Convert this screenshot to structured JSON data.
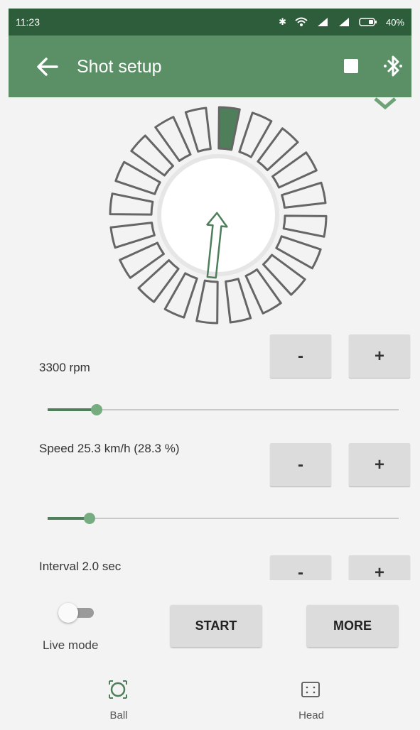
{
  "status_bar": {
    "time": "11:23",
    "battery": "40%",
    "icons": [
      "bluetooth-icon",
      "wifi-icon",
      "signal-icon",
      "signal-icon",
      "battery-icon"
    ]
  },
  "app_bar": {
    "title": "Shot setup",
    "icons": [
      "back-arrow-icon",
      "stop-icon",
      "bluetooth-icon"
    ]
  },
  "dial": {
    "segment_count": 20,
    "selected_segment": 0,
    "arrow_direction": "toward selected segment"
  },
  "controls": {
    "rpm": {
      "label": "3300 rpm",
      "minus": "-",
      "plus": "+",
      "level": 0.14
    },
    "speed": {
      "label": "Speed 25.3 km/h (28.3 %)",
      "minus": "-",
      "plus": "+",
      "level": 0.12
    },
    "interval": {
      "label": "Interval 2.0 sec",
      "minus": "-",
      "plus": "+"
    }
  },
  "bottom": {
    "live_mode": {
      "label": "Live mode",
      "on": false
    },
    "start_label": "START",
    "more_label": "MORE",
    "nav": [
      {
        "label": "Ball",
        "icon": "ball-icon",
        "active": true
      },
      {
        "label": "Head",
        "icon": "head-icon",
        "active": false
      }
    ]
  },
  "colors": {
    "status_bar": "#2e5d3b",
    "app_bar": "#5b8f66",
    "accent": "#4f7f5a",
    "selected_segment": "#4f7f5a",
    "button": "#dcdcdc"
  }
}
